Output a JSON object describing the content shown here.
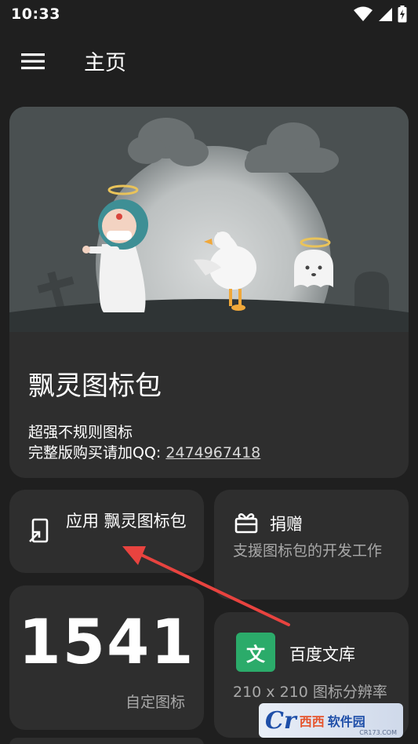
{
  "status_bar": {
    "time": "10:33"
  },
  "app_bar": {
    "title": "主页"
  },
  "hero": {
    "title": "飘灵图标包",
    "line1": "超强不规则图标",
    "line2_prefix": "完整版购买请加QQ: ",
    "qq_number": "2474967418"
  },
  "apply": {
    "label": "应用 飘灵图标包"
  },
  "donate": {
    "label": "捐赠",
    "description": "支援图标包的开发工作"
  },
  "icon_count": {
    "value": "1541",
    "label": "自定图标"
  },
  "baidu": {
    "icon_char": "文",
    "label": "百度文库",
    "description": "210 x 210 图标分辨率"
  },
  "watermark": {
    "logo": "Cr",
    "text_a": "西西",
    "text_b": "软件园",
    "url": "CR173.COM"
  },
  "colors": {
    "background": "#1f1f1f",
    "card": "#2e2e2e",
    "annotation_arrow": "#e8433f",
    "baidu_green": "#2bab6a"
  },
  "icons": [
    "menu-icon",
    "wifi-icon",
    "signal-icon",
    "battery-charging-icon",
    "apply-icon",
    "gift-icon",
    "wenku-icon"
  ]
}
